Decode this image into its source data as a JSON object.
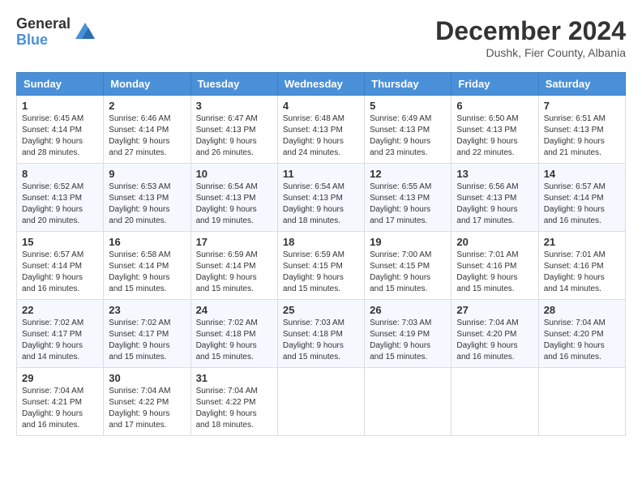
{
  "logo": {
    "general": "General",
    "blue": "Blue"
  },
  "title": "December 2024",
  "location": "Dushk, Fier County, Albania",
  "weekdays": [
    "Sunday",
    "Monday",
    "Tuesday",
    "Wednesday",
    "Thursday",
    "Friday",
    "Saturday"
  ],
  "weeks": [
    [
      {
        "day": "1",
        "sunrise": "6:45 AM",
        "sunset": "4:14 PM",
        "daylight": "9 hours and 28 minutes."
      },
      {
        "day": "2",
        "sunrise": "6:46 AM",
        "sunset": "4:14 PM",
        "daylight": "9 hours and 27 minutes."
      },
      {
        "day": "3",
        "sunrise": "6:47 AM",
        "sunset": "4:13 PM",
        "daylight": "9 hours and 26 minutes."
      },
      {
        "day": "4",
        "sunrise": "6:48 AM",
        "sunset": "4:13 PM",
        "daylight": "9 hours and 24 minutes."
      },
      {
        "day": "5",
        "sunrise": "6:49 AM",
        "sunset": "4:13 PM",
        "daylight": "9 hours and 23 minutes."
      },
      {
        "day": "6",
        "sunrise": "6:50 AM",
        "sunset": "4:13 PM",
        "daylight": "9 hours and 22 minutes."
      },
      {
        "day": "7",
        "sunrise": "6:51 AM",
        "sunset": "4:13 PM",
        "daylight": "9 hours and 21 minutes."
      }
    ],
    [
      {
        "day": "8",
        "sunrise": "6:52 AM",
        "sunset": "4:13 PM",
        "daylight": "9 hours and 20 minutes."
      },
      {
        "day": "9",
        "sunrise": "6:53 AM",
        "sunset": "4:13 PM",
        "daylight": "9 hours and 20 minutes."
      },
      {
        "day": "10",
        "sunrise": "6:54 AM",
        "sunset": "4:13 PM",
        "daylight": "9 hours and 19 minutes."
      },
      {
        "day": "11",
        "sunrise": "6:54 AM",
        "sunset": "4:13 PM",
        "daylight": "9 hours and 18 minutes."
      },
      {
        "day": "12",
        "sunrise": "6:55 AM",
        "sunset": "4:13 PM",
        "daylight": "9 hours and 17 minutes."
      },
      {
        "day": "13",
        "sunrise": "6:56 AM",
        "sunset": "4:13 PM",
        "daylight": "9 hours and 17 minutes."
      },
      {
        "day": "14",
        "sunrise": "6:57 AM",
        "sunset": "4:14 PM",
        "daylight": "9 hours and 16 minutes."
      }
    ],
    [
      {
        "day": "15",
        "sunrise": "6:57 AM",
        "sunset": "4:14 PM",
        "daylight": "9 hours and 16 minutes."
      },
      {
        "day": "16",
        "sunrise": "6:58 AM",
        "sunset": "4:14 PM",
        "daylight": "9 hours and 15 minutes."
      },
      {
        "day": "17",
        "sunrise": "6:59 AM",
        "sunset": "4:14 PM",
        "daylight": "9 hours and 15 minutes."
      },
      {
        "day": "18",
        "sunrise": "6:59 AM",
        "sunset": "4:15 PM",
        "daylight": "9 hours and 15 minutes."
      },
      {
        "day": "19",
        "sunrise": "7:00 AM",
        "sunset": "4:15 PM",
        "daylight": "9 hours and 15 minutes."
      },
      {
        "day": "20",
        "sunrise": "7:01 AM",
        "sunset": "4:16 PM",
        "daylight": "9 hours and 15 minutes."
      },
      {
        "day": "21",
        "sunrise": "7:01 AM",
        "sunset": "4:16 PM",
        "daylight": "9 hours and 14 minutes."
      }
    ],
    [
      {
        "day": "22",
        "sunrise": "7:02 AM",
        "sunset": "4:17 PM",
        "daylight": "9 hours and 14 minutes."
      },
      {
        "day": "23",
        "sunrise": "7:02 AM",
        "sunset": "4:17 PM",
        "daylight": "9 hours and 15 minutes."
      },
      {
        "day": "24",
        "sunrise": "7:02 AM",
        "sunset": "4:18 PM",
        "daylight": "9 hours and 15 minutes."
      },
      {
        "day": "25",
        "sunrise": "7:03 AM",
        "sunset": "4:18 PM",
        "daylight": "9 hours and 15 minutes."
      },
      {
        "day": "26",
        "sunrise": "7:03 AM",
        "sunset": "4:19 PM",
        "daylight": "9 hours and 15 minutes."
      },
      {
        "day": "27",
        "sunrise": "7:04 AM",
        "sunset": "4:20 PM",
        "daylight": "9 hours and 16 minutes."
      },
      {
        "day": "28",
        "sunrise": "7:04 AM",
        "sunset": "4:20 PM",
        "daylight": "9 hours and 16 minutes."
      }
    ],
    [
      {
        "day": "29",
        "sunrise": "7:04 AM",
        "sunset": "4:21 PM",
        "daylight": "9 hours and 16 minutes."
      },
      {
        "day": "30",
        "sunrise": "7:04 AM",
        "sunset": "4:22 PM",
        "daylight": "9 hours and 17 minutes."
      },
      {
        "day": "31",
        "sunrise": "7:04 AM",
        "sunset": "4:22 PM",
        "daylight": "9 hours and 18 minutes."
      },
      null,
      null,
      null,
      null
    ]
  ],
  "labels": {
    "sunrise": "Sunrise: ",
    "sunset": "Sunset: ",
    "daylight": "Daylight: "
  }
}
